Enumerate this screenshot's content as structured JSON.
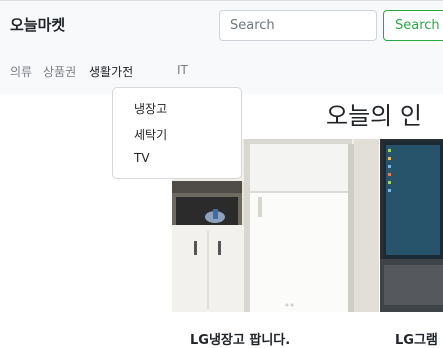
{
  "brand": "오늘마켓",
  "search": {
    "placeholder": "Search",
    "button_label": "Search"
  },
  "nav": {
    "items": [
      "의류",
      "상품권",
      "생활가전",
      "IT"
    ],
    "active_index": 2
  },
  "dropdown": {
    "items": [
      "냉장고",
      "세탁기",
      "TV"
    ]
  },
  "headline": "오늘의 인",
  "products": [
    {
      "caption": "LG냉장고 팝니다."
    },
    {
      "caption": "LG그램"
    }
  ],
  "colors": {
    "navbar_bg": "#f8f9fa",
    "search_button": "#28a745"
  }
}
